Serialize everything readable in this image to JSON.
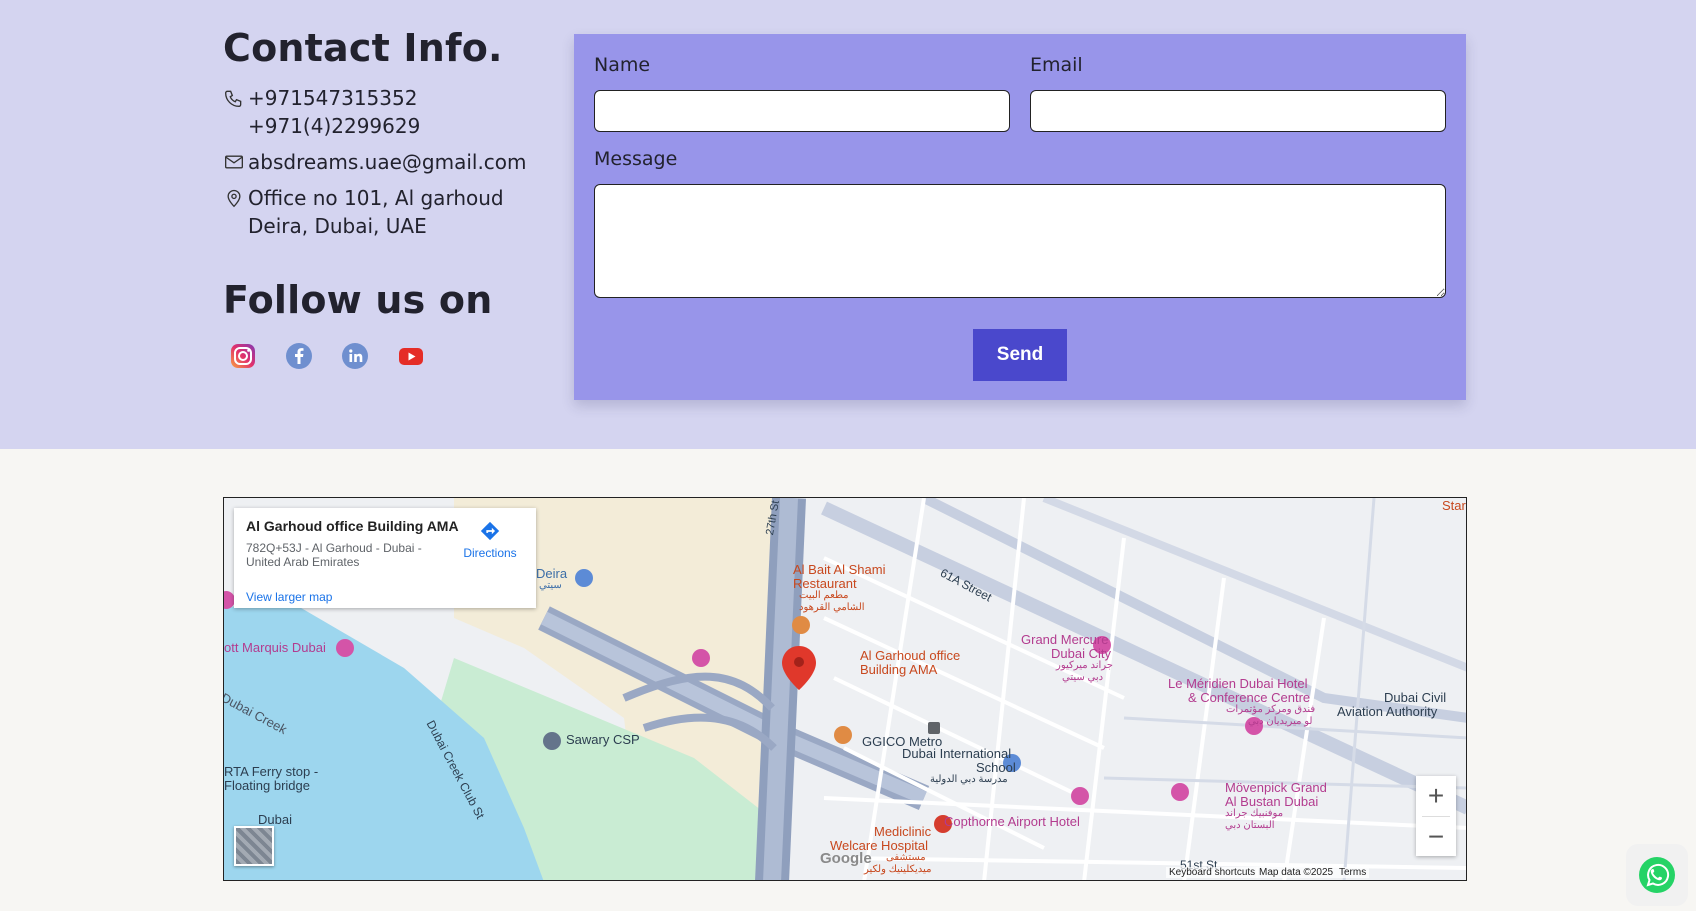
{
  "contact": {
    "heading": "Contact Info.",
    "phone_1": "+971547315352",
    "phone_2": "+971(4)2299629",
    "email": "absdreams.uae@gmail.com",
    "address_1": "Office no 101, Al garhoud",
    "address_2": "Deira, Dubai, UAE"
  },
  "follow": {
    "heading": "Follow us on",
    "icons": [
      "instagram-icon",
      "facebook-icon",
      "linkedin-icon",
      "youtube-icon"
    ]
  },
  "form": {
    "name_label": "Name",
    "email_label": "Email",
    "message_label": "Message",
    "name_value": "",
    "email_value": "",
    "message_value": "",
    "send_label": "Send"
  },
  "map": {
    "card_title": "Al Garhoud office Building AMA",
    "card_address": "782Q+53J - Al Garhoud - Dubai - United Arab Emirates",
    "view_larger": "View larger map",
    "directions": "Directions",
    "labels": {
      "deira": "Deira",
      "deira_ar": "سيتي",
      "marquis": "JW Marriott Marquis Dubai",
      "creek": "Dubai Creek",
      "creek_club": "Dubai Creek Club St",
      "sawary": "Sawary CSP",
      "ferry_1": "RTA Ferry stop -",
      "ferry_2": "Floating bridge",
      "dubai": "Dubai",
      "albait_1": "Al Bait Al Shami",
      "albait_2": "Restaurant",
      "albait_ar_1": "مطعم البيت",
      "albait_ar_2": "الشامي القرهود",
      "office_1": "Al Garhoud office",
      "office_2": "Building AMA",
      "ggico": "GGICO Metro",
      "school_1": "Dubai International",
      "school_2": "School",
      "school_ar": "مدرسة دبي الدولية",
      "copthorne": "Copthorne Airport Hotel",
      "mediclinic_1": "Mediclinic",
      "mediclinic_2": "Welcare Hospital",
      "mediclinic_ar_1": "مستشفى",
      "mediclinic_ar_2": "ميديكلينيك ولكير",
      "grand_1": "Grand Mercure",
      "grand_2": "Dubai City",
      "grand_ar_1": "جراند ميركيور",
      "grand_ar_2": "دبي سيتي",
      "meridien_1": "Le Méridien Dubai Hotel",
      "meridien_2": "& Conference Centre",
      "meridien_ar_1": "فندق ومركز مؤتمرات",
      "meridien_ar_2": "لو ميريديان دبي",
      "dcaa_1": "Dubai Civil",
      "dcaa_2": "Aviation Authority",
      "movenpick_1": "Mövenpick Grand",
      "movenpick_2": "Al Bustan Dubai",
      "movenpick_ar_1": "موفنبيك جراند",
      "movenpick_ar_2": "البستان دبي",
      "street_61a": "61A Street",
      "street_27th": "27th St",
      "street_51st": "51st St",
      "star": "Star"
    },
    "keyboard": "Keyboard shortcuts",
    "map_data": "Map data ©2025",
    "terms": "Terms",
    "google": "Google"
  },
  "colors": {
    "band": "#d4d4f0",
    "panel": "#9895ea",
    "button": "#4a48cc",
    "water": "#9dd6ee",
    "park": "#c9ecd3"
  }
}
